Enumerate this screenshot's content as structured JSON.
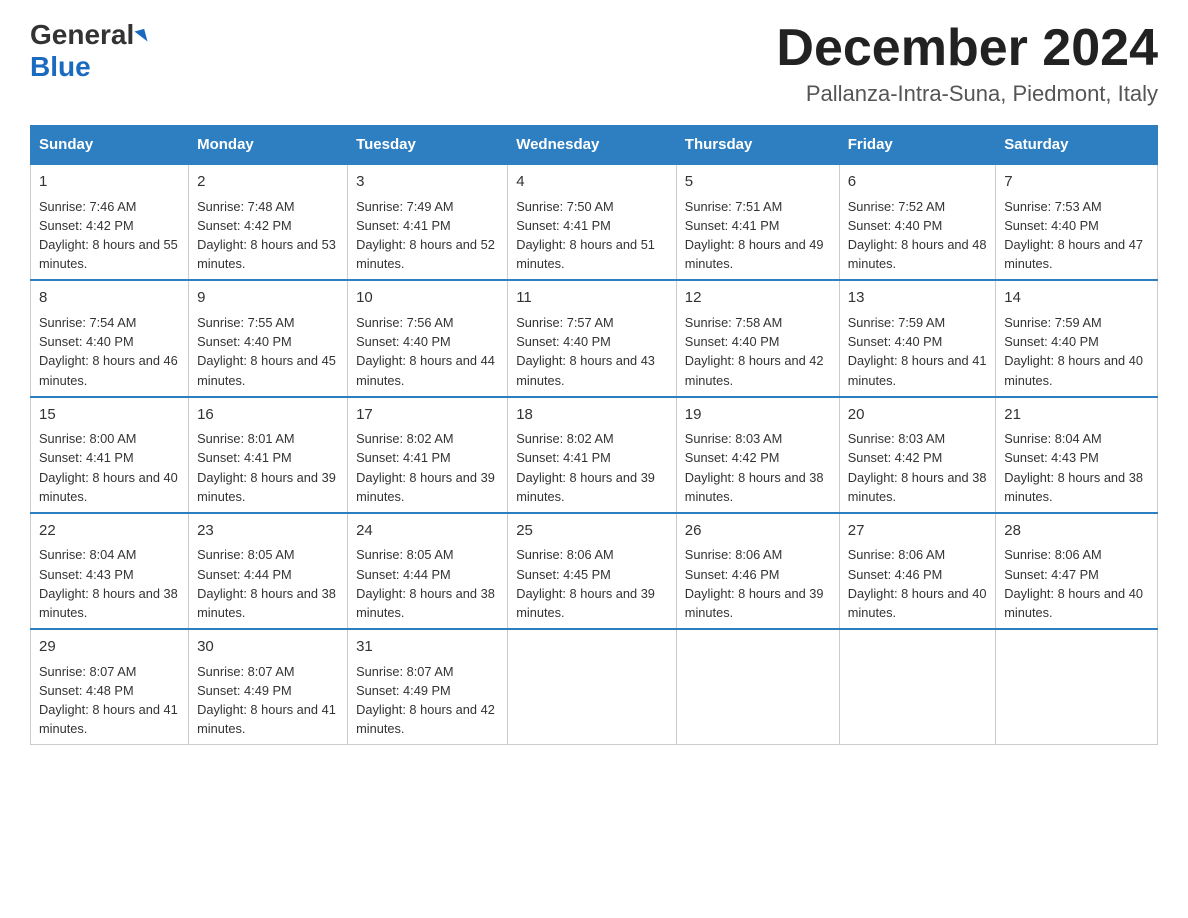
{
  "header": {
    "logo_line1": "General",
    "logo_line2": "Blue",
    "month_title": "December 2024",
    "subtitle": "Pallanza-Intra-Suna, Piedmont, Italy"
  },
  "days_of_week": [
    "Sunday",
    "Monday",
    "Tuesday",
    "Wednesday",
    "Thursday",
    "Friday",
    "Saturday"
  ],
  "weeks": [
    [
      {
        "day": "1",
        "sunrise": "7:46 AM",
        "sunset": "4:42 PM",
        "daylight": "8 hours and 55 minutes."
      },
      {
        "day": "2",
        "sunrise": "7:48 AM",
        "sunset": "4:42 PM",
        "daylight": "8 hours and 53 minutes."
      },
      {
        "day": "3",
        "sunrise": "7:49 AM",
        "sunset": "4:41 PM",
        "daylight": "8 hours and 52 minutes."
      },
      {
        "day": "4",
        "sunrise": "7:50 AM",
        "sunset": "4:41 PM",
        "daylight": "8 hours and 51 minutes."
      },
      {
        "day": "5",
        "sunrise": "7:51 AM",
        "sunset": "4:41 PM",
        "daylight": "8 hours and 49 minutes."
      },
      {
        "day": "6",
        "sunrise": "7:52 AM",
        "sunset": "4:40 PM",
        "daylight": "8 hours and 48 minutes."
      },
      {
        "day": "7",
        "sunrise": "7:53 AM",
        "sunset": "4:40 PM",
        "daylight": "8 hours and 47 minutes."
      }
    ],
    [
      {
        "day": "8",
        "sunrise": "7:54 AM",
        "sunset": "4:40 PM",
        "daylight": "8 hours and 46 minutes."
      },
      {
        "day": "9",
        "sunrise": "7:55 AM",
        "sunset": "4:40 PM",
        "daylight": "8 hours and 45 minutes."
      },
      {
        "day": "10",
        "sunrise": "7:56 AM",
        "sunset": "4:40 PM",
        "daylight": "8 hours and 44 minutes."
      },
      {
        "day": "11",
        "sunrise": "7:57 AM",
        "sunset": "4:40 PM",
        "daylight": "8 hours and 43 minutes."
      },
      {
        "day": "12",
        "sunrise": "7:58 AM",
        "sunset": "4:40 PM",
        "daylight": "8 hours and 42 minutes."
      },
      {
        "day": "13",
        "sunrise": "7:59 AM",
        "sunset": "4:40 PM",
        "daylight": "8 hours and 41 minutes."
      },
      {
        "day": "14",
        "sunrise": "7:59 AM",
        "sunset": "4:40 PM",
        "daylight": "8 hours and 40 minutes."
      }
    ],
    [
      {
        "day": "15",
        "sunrise": "8:00 AM",
        "sunset": "4:41 PM",
        "daylight": "8 hours and 40 minutes."
      },
      {
        "day": "16",
        "sunrise": "8:01 AM",
        "sunset": "4:41 PM",
        "daylight": "8 hours and 39 minutes."
      },
      {
        "day": "17",
        "sunrise": "8:02 AM",
        "sunset": "4:41 PM",
        "daylight": "8 hours and 39 minutes."
      },
      {
        "day": "18",
        "sunrise": "8:02 AM",
        "sunset": "4:41 PM",
        "daylight": "8 hours and 39 minutes."
      },
      {
        "day": "19",
        "sunrise": "8:03 AM",
        "sunset": "4:42 PM",
        "daylight": "8 hours and 38 minutes."
      },
      {
        "day": "20",
        "sunrise": "8:03 AM",
        "sunset": "4:42 PM",
        "daylight": "8 hours and 38 minutes."
      },
      {
        "day": "21",
        "sunrise": "8:04 AM",
        "sunset": "4:43 PM",
        "daylight": "8 hours and 38 minutes."
      }
    ],
    [
      {
        "day": "22",
        "sunrise": "8:04 AM",
        "sunset": "4:43 PM",
        "daylight": "8 hours and 38 minutes."
      },
      {
        "day": "23",
        "sunrise": "8:05 AM",
        "sunset": "4:44 PM",
        "daylight": "8 hours and 38 minutes."
      },
      {
        "day": "24",
        "sunrise": "8:05 AM",
        "sunset": "4:44 PM",
        "daylight": "8 hours and 38 minutes."
      },
      {
        "day": "25",
        "sunrise": "8:06 AM",
        "sunset": "4:45 PM",
        "daylight": "8 hours and 39 minutes."
      },
      {
        "day": "26",
        "sunrise": "8:06 AM",
        "sunset": "4:46 PM",
        "daylight": "8 hours and 39 minutes."
      },
      {
        "day": "27",
        "sunrise": "8:06 AM",
        "sunset": "4:46 PM",
        "daylight": "8 hours and 40 minutes."
      },
      {
        "day": "28",
        "sunrise": "8:06 AM",
        "sunset": "4:47 PM",
        "daylight": "8 hours and 40 minutes."
      }
    ],
    [
      {
        "day": "29",
        "sunrise": "8:07 AM",
        "sunset": "4:48 PM",
        "daylight": "8 hours and 41 minutes."
      },
      {
        "day": "30",
        "sunrise": "8:07 AM",
        "sunset": "4:49 PM",
        "daylight": "8 hours and 41 minutes."
      },
      {
        "day": "31",
        "sunrise": "8:07 AM",
        "sunset": "4:49 PM",
        "daylight": "8 hours and 42 minutes."
      },
      {
        "day": "",
        "sunrise": "",
        "sunset": "",
        "daylight": ""
      },
      {
        "day": "",
        "sunrise": "",
        "sunset": "",
        "daylight": ""
      },
      {
        "day": "",
        "sunrise": "",
        "sunset": "",
        "daylight": ""
      },
      {
        "day": "",
        "sunrise": "",
        "sunset": "",
        "daylight": ""
      }
    ]
  ]
}
